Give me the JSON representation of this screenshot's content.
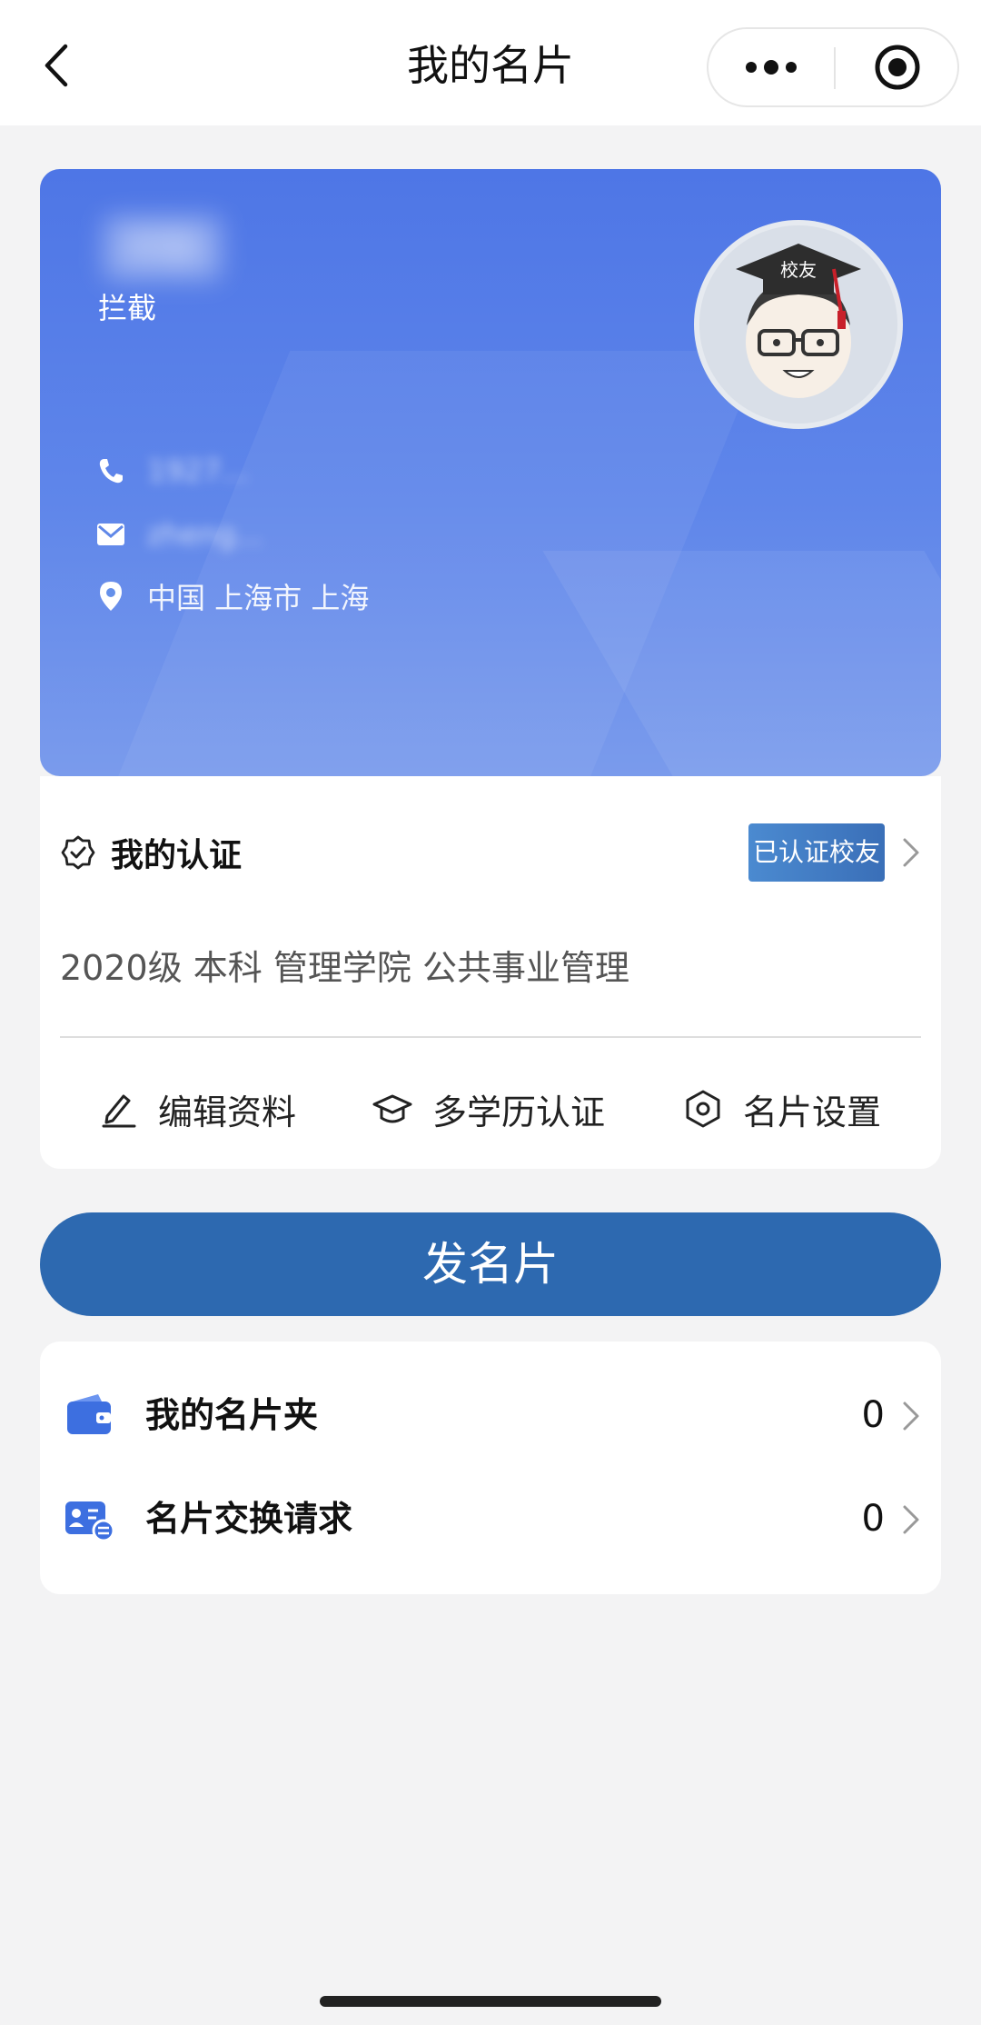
{
  "header": {
    "title": "我的名片"
  },
  "card": {
    "name": "郑勤",
    "tag": "拦截",
    "phone": "1927...",
    "email": "zheng...",
    "location": "中国 上海市 上海",
    "avatar_text": "校友"
  },
  "certification": {
    "title": "我的认证",
    "badge": "已认证校友",
    "education": "2020级 本科 管理学院 公共事业管理"
  },
  "actions": [
    {
      "label": "编辑资料",
      "icon": "edit-icon"
    },
    {
      "label": "多学历认证",
      "icon": "graduation-cap-icon"
    },
    {
      "label": "名片设置",
      "icon": "settings-icon"
    }
  ],
  "send_button": "发名片",
  "list": [
    {
      "label": "我的名片夹",
      "count": "0",
      "icon": "wallet-icon"
    },
    {
      "label": "名片交换请求",
      "count": "0",
      "icon": "exchange-card-icon"
    }
  ],
  "colors": {
    "card_blue": "#5a80e8",
    "button_blue": "#2d69b0",
    "badge_blue": "#3f7cc4"
  }
}
